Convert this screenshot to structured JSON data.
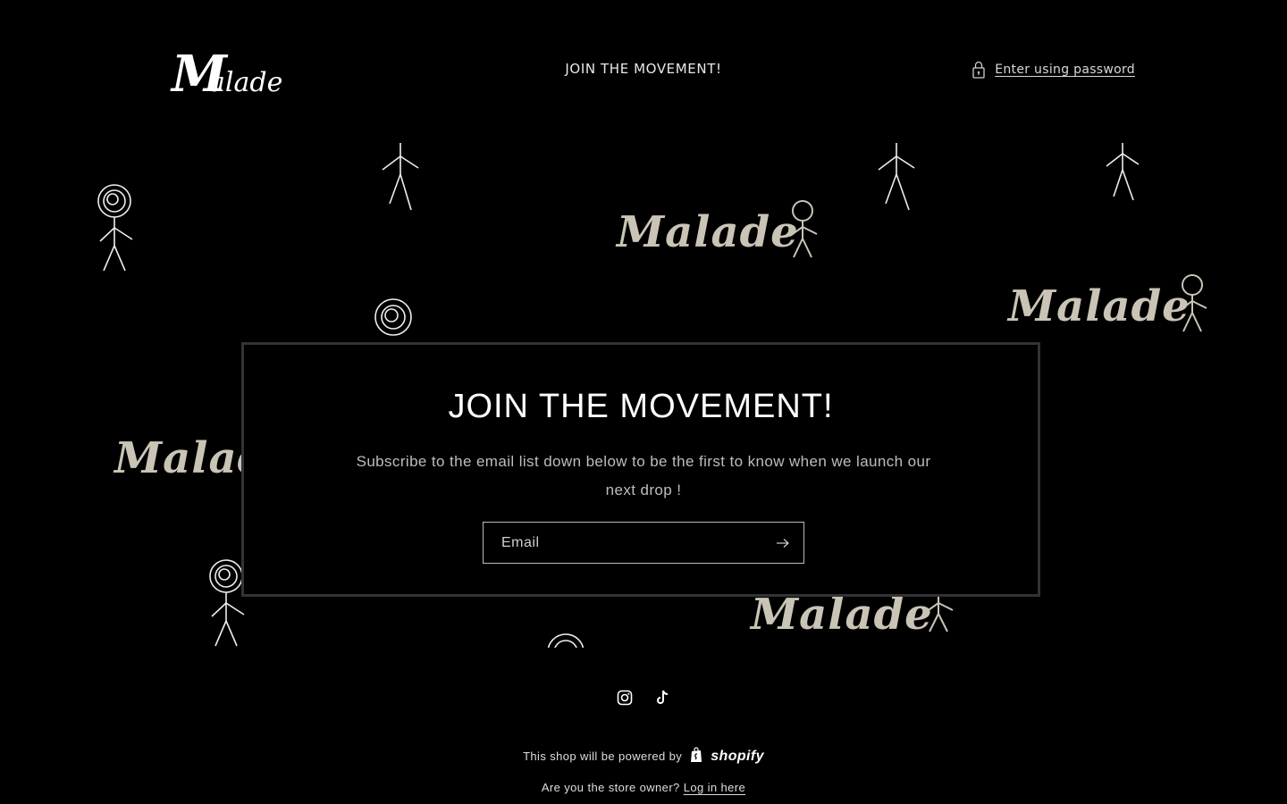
{
  "header": {
    "logo_text": "Malade",
    "title": "JOIN THE MOVEMENT!",
    "enter_password_label": "Enter using password"
  },
  "banner": {
    "logo_text": "Malade"
  },
  "modal": {
    "title": "JOIN THE MOVEMENT!",
    "text": "Subscribe to the email list down below to be the first to know when we launch our next drop !",
    "email_placeholder": "Email"
  },
  "footer": {
    "social_icons": [
      "instagram-icon",
      "tiktok-icon"
    ],
    "powered_by_text": "This shop will be powered by",
    "brand": "shopify",
    "owner_text": "Are you the store owner?",
    "login_link": "Log in here"
  },
  "colors": {
    "background": "#000000",
    "banner_logo": "#c9c4b5",
    "modal_border": "#333333"
  }
}
